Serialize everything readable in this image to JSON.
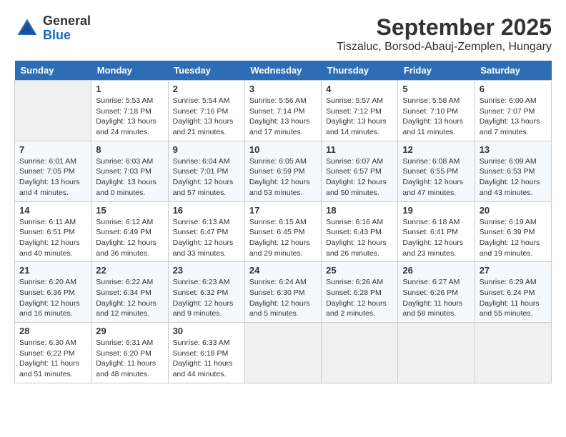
{
  "header": {
    "logo_general": "General",
    "logo_blue": "Blue",
    "month_title": "September 2025",
    "location": "Tiszaluc, Borsod-Abauj-Zemplen, Hungary"
  },
  "columns": [
    "Sunday",
    "Monday",
    "Tuesday",
    "Wednesday",
    "Thursday",
    "Friday",
    "Saturday"
  ],
  "weeks": [
    [
      {
        "day": "",
        "sunrise": "",
        "sunset": "",
        "daylight": "",
        "empty": true
      },
      {
        "day": "1",
        "sunrise": "Sunrise: 5:53 AM",
        "sunset": "Sunset: 7:18 PM",
        "daylight": "Daylight: 13 hours and 24 minutes."
      },
      {
        "day": "2",
        "sunrise": "Sunrise: 5:54 AM",
        "sunset": "Sunset: 7:16 PM",
        "daylight": "Daylight: 13 hours and 21 minutes."
      },
      {
        "day": "3",
        "sunrise": "Sunrise: 5:56 AM",
        "sunset": "Sunset: 7:14 PM",
        "daylight": "Daylight: 13 hours and 17 minutes."
      },
      {
        "day": "4",
        "sunrise": "Sunrise: 5:57 AM",
        "sunset": "Sunset: 7:12 PM",
        "daylight": "Daylight: 13 hours and 14 minutes."
      },
      {
        "day": "5",
        "sunrise": "Sunrise: 5:58 AM",
        "sunset": "Sunset: 7:10 PM",
        "daylight": "Daylight: 13 hours and 11 minutes."
      },
      {
        "day": "6",
        "sunrise": "Sunrise: 6:00 AM",
        "sunset": "Sunset: 7:07 PM",
        "daylight": "Daylight: 13 hours and 7 minutes."
      }
    ],
    [
      {
        "day": "7",
        "sunrise": "Sunrise: 6:01 AM",
        "sunset": "Sunset: 7:05 PM",
        "daylight": "Daylight: 13 hours and 4 minutes."
      },
      {
        "day": "8",
        "sunrise": "Sunrise: 6:03 AM",
        "sunset": "Sunset: 7:03 PM",
        "daylight": "Daylight: 13 hours and 0 minutes."
      },
      {
        "day": "9",
        "sunrise": "Sunrise: 6:04 AM",
        "sunset": "Sunset: 7:01 PM",
        "daylight": "Daylight: 12 hours and 57 minutes."
      },
      {
        "day": "10",
        "sunrise": "Sunrise: 6:05 AM",
        "sunset": "Sunset: 6:59 PM",
        "daylight": "Daylight: 12 hours and 53 minutes."
      },
      {
        "day": "11",
        "sunrise": "Sunrise: 6:07 AM",
        "sunset": "Sunset: 6:57 PM",
        "daylight": "Daylight: 12 hours and 50 minutes."
      },
      {
        "day": "12",
        "sunrise": "Sunrise: 6:08 AM",
        "sunset": "Sunset: 6:55 PM",
        "daylight": "Daylight: 12 hours and 47 minutes."
      },
      {
        "day": "13",
        "sunrise": "Sunrise: 6:09 AM",
        "sunset": "Sunset: 6:53 PM",
        "daylight": "Daylight: 12 hours and 43 minutes."
      }
    ],
    [
      {
        "day": "14",
        "sunrise": "Sunrise: 6:11 AM",
        "sunset": "Sunset: 6:51 PM",
        "daylight": "Daylight: 12 hours and 40 minutes."
      },
      {
        "day": "15",
        "sunrise": "Sunrise: 6:12 AM",
        "sunset": "Sunset: 6:49 PM",
        "daylight": "Daylight: 12 hours and 36 minutes."
      },
      {
        "day": "16",
        "sunrise": "Sunrise: 6:13 AM",
        "sunset": "Sunset: 6:47 PM",
        "daylight": "Daylight: 12 hours and 33 minutes."
      },
      {
        "day": "17",
        "sunrise": "Sunrise: 6:15 AM",
        "sunset": "Sunset: 6:45 PM",
        "daylight": "Daylight: 12 hours and 29 minutes."
      },
      {
        "day": "18",
        "sunrise": "Sunrise: 6:16 AM",
        "sunset": "Sunset: 6:43 PM",
        "daylight": "Daylight: 12 hours and 26 minutes."
      },
      {
        "day": "19",
        "sunrise": "Sunrise: 6:18 AM",
        "sunset": "Sunset: 6:41 PM",
        "daylight": "Daylight: 12 hours and 23 minutes."
      },
      {
        "day": "20",
        "sunrise": "Sunrise: 6:19 AM",
        "sunset": "Sunset: 6:39 PM",
        "daylight": "Daylight: 12 hours and 19 minutes."
      }
    ],
    [
      {
        "day": "21",
        "sunrise": "Sunrise: 6:20 AM",
        "sunset": "Sunset: 6:36 PM",
        "daylight": "Daylight: 12 hours and 16 minutes."
      },
      {
        "day": "22",
        "sunrise": "Sunrise: 6:22 AM",
        "sunset": "Sunset: 6:34 PM",
        "daylight": "Daylight: 12 hours and 12 minutes."
      },
      {
        "day": "23",
        "sunrise": "Sunrise: 6:23 AM",
        "sunset": "Sunset: 6:32 PM",
        "daylight": "Daylight: 12 hours and 9 minutes."
      },
      {
        "day": "24",
        "sunrise": "Sunrise: 6:24 AM",
        "sunset": "Sunset: 6:30 PM",
        "daylight": "Daylight: 12 hours and 5 minutes."
      },
      {
        "day": "25",
        "sunrise": "Sunrise: 6:26 AM",
        "sunset": "Sunset: 6:28 PM",
        "daylight": "Daylight: 12 hours and 2 minutes."
      },
      {
        "day": "26",
        "sunrise": "Sunrise: 6:27 AM",
        "sunset": "Sunset: 6:26 PM",
        "daylight": "Daylight: 11 hours and 58 minutes."
      },
      {
        "day": "27",
        "sunrise": "Sunrise: 6:29 AM",
        "sunset": "Sunset: 6:24 PM",
        "daylight": "Daylight: 11 hours and 55 minutes."
      }
    ],
    [
      {
        "day": "28",
        "sunrise": "Sunrise: 6:30 AM",
        "sunset": "Sunset: 6:22 PM",
        "daylight": "Daylight: 11 hours and 51 minutes."
      },
      {
        "day": "29",
        "sunrise": "Sunrise: 6:31 AM",
        "sunset": "Sunset: 6:20 PM",
        "daylight": "Daylight: 11 hours and 48 minutes."
      },
      {
        "day": "30",
        "sunrise": "Sunrise: 6:33 AM",
        "sunset": "Sunset: 6:18 PM",
        "daylight": "Daylight: 11 hours and 44 minutes."
      },
      {
        "day": "",
        "sunrise": "",
        "sunset": "",
        "daylight": "",
        "empty": true
      },
      {
        "day": "",
        "sunrise": "",
        "sunset": "",
        "daylight": "",
        "empty": true
      },
      {
        "day": "",
        "sunrise": "",
        "sunset": "",
        "daylight": "",
        "empty": true
      },
      {
        "day": "",
        "sunrise": "",
        "sunset": "",
        "daylight": "",
        "empty": true
      }
    ]
  ]
}
